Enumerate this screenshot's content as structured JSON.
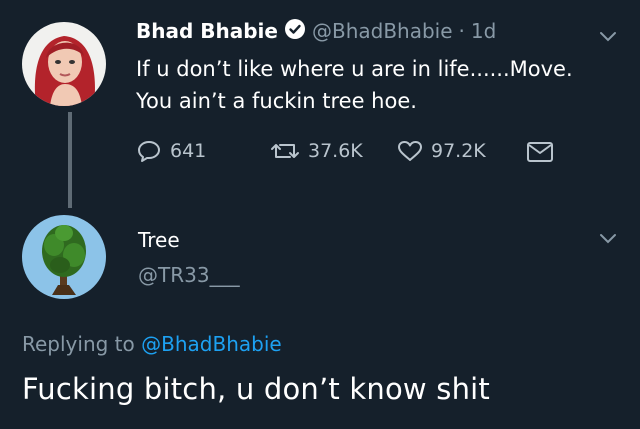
{
  "tweet1": {
    "name": "Bhad Bhabie",
    "handle": "@BhadBhabie",
    "separator": "·",
    "time": "1d",
    "lines": [
      "If u don’t like where u are in life......Move.",
      "You ain’t a fuckin tree hoe."
    ],
    "replies": "641",
    "retweets": "37.6K",
    "likes": "97.2K"
  },
  "tweet2": {
    "name": "Tree",
    "handle": "@TR33___",
    "replying_label": "Replying to",
    "replying_to": "@BhadBhabie",
    "text": "Fucking bitch, u don’t know shit"
  },
  "colors": {
    "background": "#15202b",
    "muted": "#8899a6",
    "link": "#1da1f2",
    "verified": "#ffffff"
  },
  "icons": [
    "verified-badge-icon",
    "chevron-down-icon",
    "reply-icon",
    "retweet-icon",
    "like-icon",
    "message-icon"
  ]
}
